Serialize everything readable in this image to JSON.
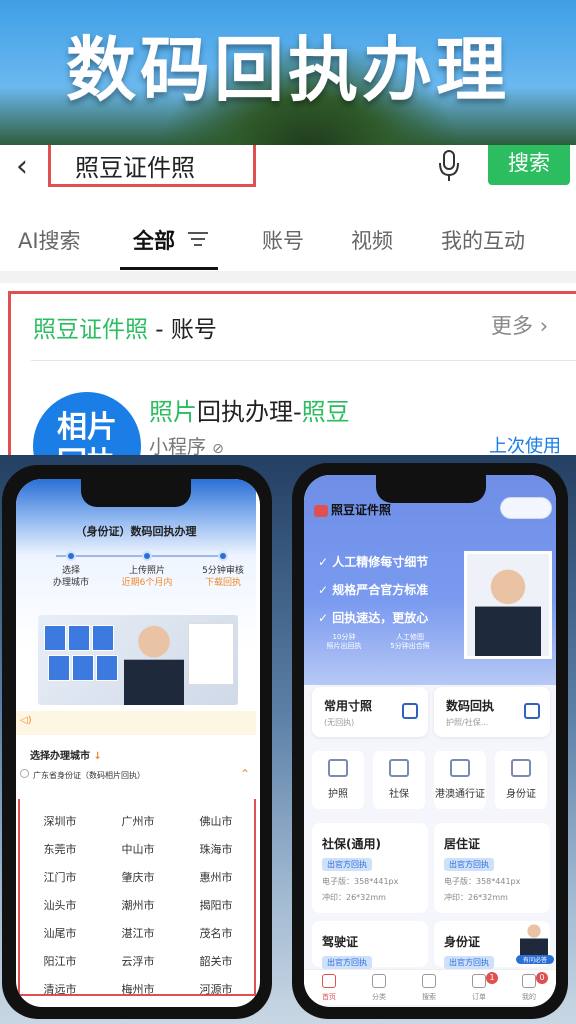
{
  "banner": {
    "title": "数码回执办理"
  },
  "search": {
    "back_icon": "back-chevron-icon",
    "query": "照豆证件照",
    "mic_icon": "microphone-icon",
    "button": "搜索",
    "tabs": [
      "AI搜索",
      "全部",
      "账号",
      "视频",
      "我的互动"
    ],
    "active_tab": "全部",
    "accent": "#2dbd61",
    "highlight_border": "#e05050"
  },
  "account_card": {
    "heading_highlight": "照豆证件照",
    "heading_rest": " - 账号",
    "more": "更多",
    "logo_text_1": "相片",
    "logo_text_2": "回执",
    "app_name_part1": "照片",
    "app_name_part2": "回执办理-",
    "app_name_part3": "照豆",
    "app_type": "小程序",
    "last_used": "上次使用"
  },
  "left_phone": {
    "heading": "（身份证）数码回执办理",
    "steps": [
      {
        "line1": "选择",
        "line2": "办理城市"
      },
      {
        "line1": "上传照片",
        "line2": "近期6个月内"
      },
      {
        "line1": "5分钟审核",
        "line2": "下载回执"
      }
    ],
    "select_city": "选择办理城市",
    "province_item": "广东省身份证（数码相片回执）",
    "cities": [
      "深圳市",
      "广州市",
      "佛山市",
      "东莞市",
      "中山市",
      "珠海市",
      "江门市",
      "肇庆市",
      "惠州市",
      "汕头市",
      "潮州市",
      "揭阳市",
      "汕尾市",
      "湛江市",
      "茂名市",
      "阳江市",
      "云浮市",
      "韶关市",
      "清远市",
      "梅州市",
      "河源市"
    ]
  },
  "right_phone": {
    "title": "照豆证件照",
    "features": [
      "人工精修每寸细节",
      "规格严合官方标准",
      "回执速达，更放心"
    ],
    "badge_1_l1": "10分钟",
    "badge_1_l2": "照片出回执",
    "badge_2_l1": "人工修图",
    "badge_2_l2": "5分钟出合照",
    "quick_cards": [
      {
        "title": "常用寸照",
        "sub": "(无回执)"
      },
      {
        "title": "数码回执",
        "sub": "护照/社保..."
      }
    ],
    "categories": [
      "护照",
      "社保",
      "港澳通行证",
      "身份证"
    ],
    "list": [
      {
        "title": "社保(通用)",
        "badge": "出官方回执",
        "line1": "电子版：358*441px",
        "line2": "冲印：26*32mm"
      },
      {
        "title": "居住证",
        "badge": "出官方回执",
        "line1": "电子版：358*441px",
        "line2": "冲印：26*32mm"
      },
      {
        "title": "驾驶证",
        "badge": "出官方回执"
      },
      {
        "title": "身份证",
        "badge": "出官方回执"
      }
    ],
    "customer_service": "有问必答",
    "tabbar": [
      "首页",
      "分类",
      "搜索",
      "订单",
      "我的"
    ],
    "order_badge": "1",
    "mine_badge": "0"
  }
}
